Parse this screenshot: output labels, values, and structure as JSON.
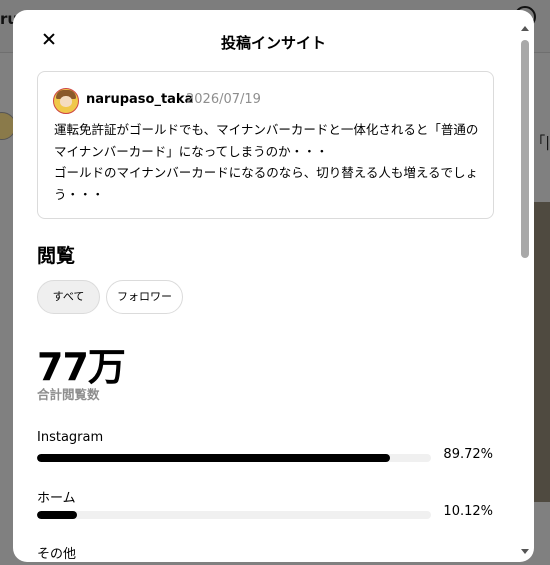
{
  "background": {
    "left_text": "ru",
    "right_text": "「|"
  },
  "modal": {
    "title": "投稿インサイト",
    "close_icon": "close-icon"
  },
  "post": {
    "username": "narupaso_taka",
    "date": "2026/07/19",
    "text": "運転免許証がゴールドでも、マイナンバーカードと一体化されると「普通の\nマイナンバーカード」になってしまうのか・・・\nゴールドのマイナンバーカードになるのなら、切り替える人も増えるでしょ\nう・・・"
  },
  "views": {
    "section_title": "閲覧",
    "filters": [
      {
        "label": "すべて",
        "active": true
      },
      {
        "label": "フォロワー",
        "active": false
      }
    ],
    "total": "77万",
    "total_caption": "合計閲覧数",
    "breakdown": [
      {
        "label": "Instagram",
        "percent_text": "89.72%",
        "fraction": 0.8972
      },
      {
        "label": "ホーム",
        "percent_text": "10.12%",
        "fraction": 0.1012
      },
      {
        "label": "その他",
        "percent_text": "",
        "fraction": 0
      }
    ]
  },
  "colors": {
    "bar_fill": "#000000",
    "bar_track": "#f0f0f0",
    "muted_text": "#8e8e8e"
  }
}
